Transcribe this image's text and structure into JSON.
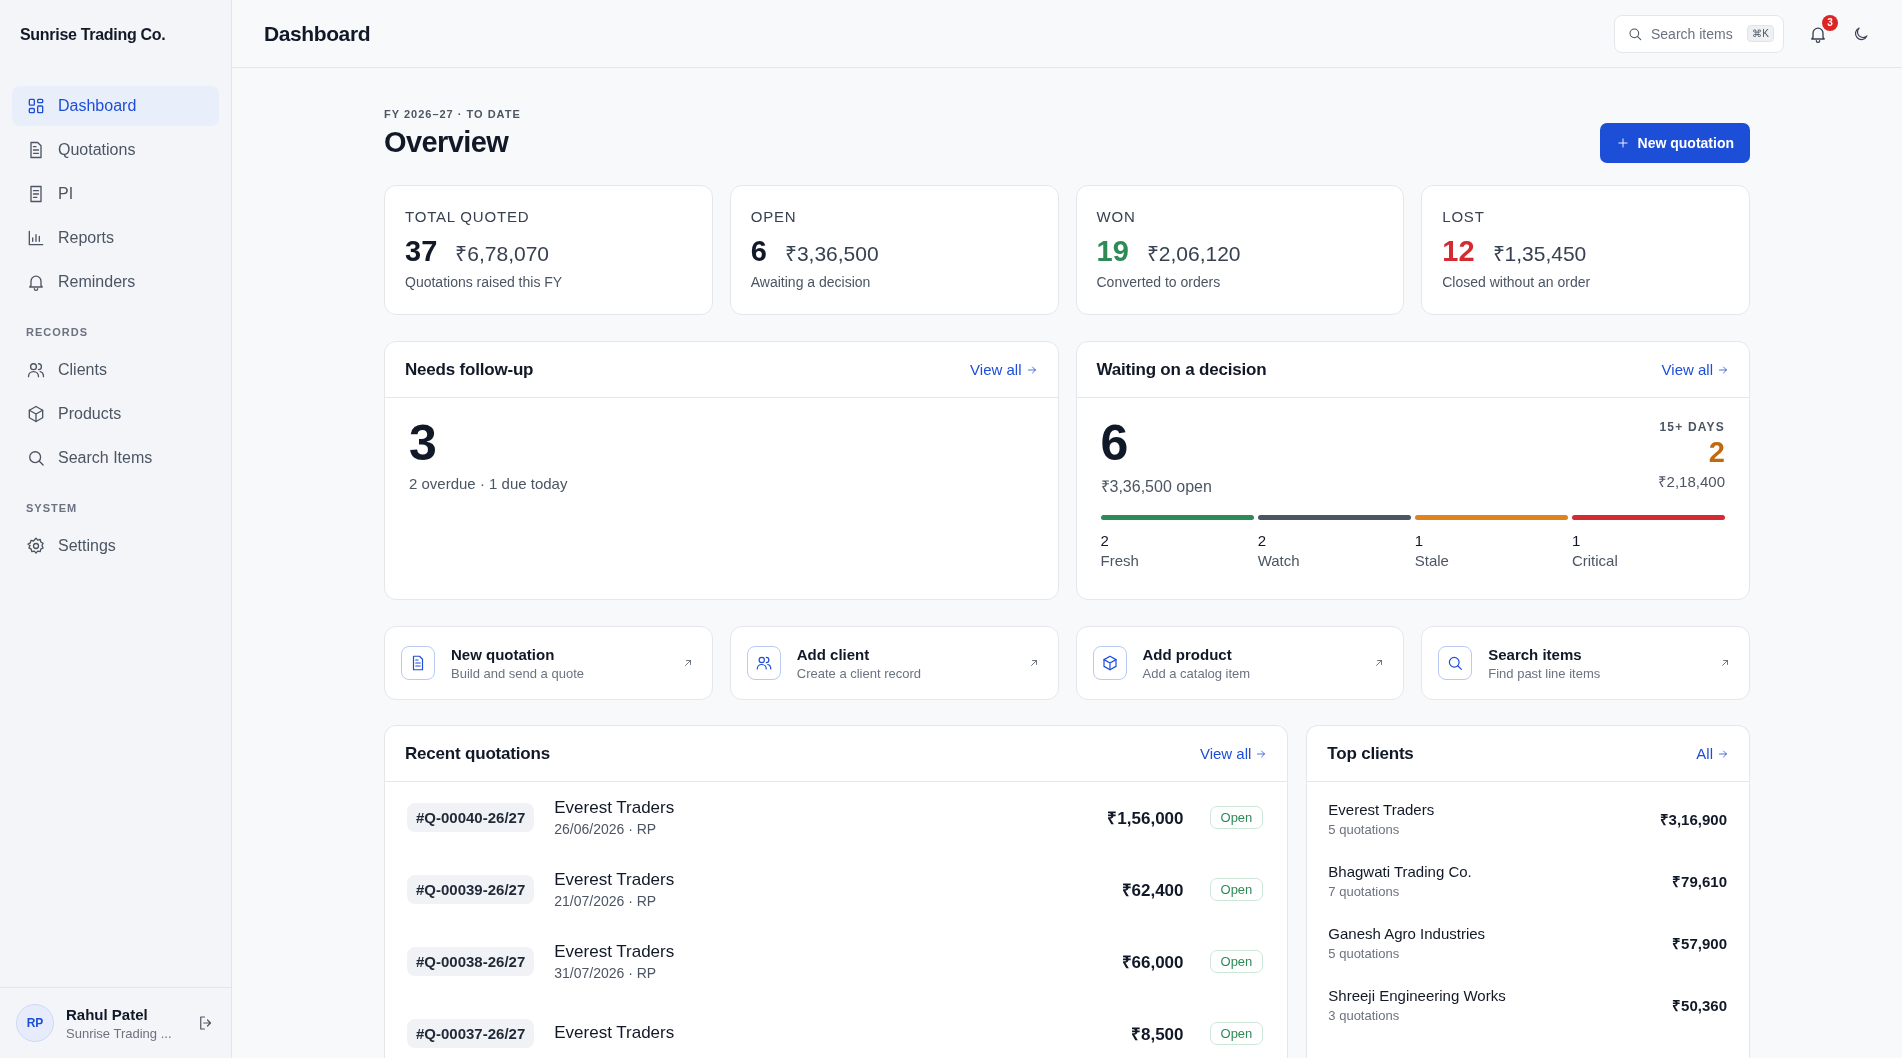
{
  "sidebar": {
    "brand": "Sunrise Trading Co.",
    "sections": [
      {
        "items": [
          {
            "label": "Dashboard",
            "selected": true
          },
          {
            "label": "Quotations",
            "selected": false
          },
          {
            "label": "PI",
            "selected": false
          },
          {
            "label": "Reports",
            "selected": false
          },
          {
            "label": "Reminders",
            "selected": false
          }
        ]
      },
      {
        "title": "RECORDS",
        "items": [
          {
            "label": "Clients",
            "selected": false
          },
          {
            "label": "Products",
            "selected": false
          },
          {
            "label": "Search Items",
            "selected": false
          }
        ]
      },
      {
        "title": "SYSTEM",
        "items": [
          {
            "label": "Settings",
            "selected": false
          }
        ]
      }
    ],
    "user": {
      "initials": "RP",
      "name": "Rahul Patel",
      "company": "Sunrise Trading ..."
    }
  },
  "header": {
    "title": "Dashboard",
    "search": {
      "placeholder": "Search items",
      "shortcut": "⌘K"
    },
    "notifications": "3"
  },
  "overview": {
    "period": "FY 2026–27 · TO DATE",
    "title": "Overview",
    "new_button": "New quotation"
  },
  "stats": [
    {
      "label": "TOTAL QUOTED",
      "count": "37",
      "kind": "neutral",
      "amount": "₹6,78,070",
      "note": "Quotations raised this FY"
    },
    {
      "label": "OPEN",
      "count": "6",
      "kind": "neutral",
      "amount": "₹3,36,500",
      "note": "Awaiting a decision"
    },
    {
      "label": "WON",
      "count": "19",
      "kind": "success",
      "amount": "₹2,06,120",
      "note": "Converted to orders"
    },
    {
      "label": "LOST",
      "count": "12",
      "kind": "danger",
      "amount": "₹1,35,450",
      "note": "Closed without an order"
    }
  ],
  "follow_up": {
    "title": "Needs follow-up",
    "link": "View all",
    "count": "3",
    "note": "2 overdue · 1 due today"
  },
  "waiting": {
    "title": "Waiting on a decision",
    "link": "View all",
    "count": "6",
    "amount": "₹3,36,500",
    "amount_suffix": "open",
    "aged_label": "15+ DAYS",
    "aged_count": "2",
    "aged_amount": "₹2,18,400",
    "stages": [
      {
        "count": "2",
        "label": "Fresh",
        "color": "#2e8b57"
      },
      {
        "count": "2",
        "label": "Watch",
        "color": "#4b5563"
      },
      {
        "count": "1",
        "label": "Stale",
        "color": "#e0821e"
      },
      {
        "count": "1",
        "label": "Critical",
        "color": "#d42a32"
      }
    ]
  },
  "quick_actions": [
    {
      "title": "New quotation",
      "subtitle": "Build and send a quote"
    },
    {
      "title": "Add client",
      "subtitle": "Create a client record"
    },
    {
      "title": "Add product",
      "subtitle": "Add a catalog item"
    },
    {
      "title": "Search items",
      "subtitle": "Find past line items"
    }
  ],
  "recent": {
    "title": "Recent quotations",
    "link": "View all",
    "rows": [
      {
        "number": "#Q-00040-26/27",
        "client": "Everest Traders",
        "meta": "26/06/2026 · RP",
        "amount": "₹1,56,000",
        "status": "Open",
        "kind": "open"
      },
      {
        "number": "#Q-00039-26/27",
        "client": "Everest Traders",
        "meta": "21/07/2026 · RP",
        "amount": "₹62,400",
        "status": "Open",
        "kind": "open"
      },
      {
        "number": "#Q-00038-26/27",
        "client": "Everest Traders",
        "meta": "31/07/2026 · RP",
        "amount": "₹66,000",
        "status": "Open",
        "kind": "open"
      },
      {
        "number": "#Q-00037-26/27",
        "client": "Everest Traders",
        "amount": "₹8,500",
        "status": "Open",
        "kind": "open"
      }
    ]
  },
  "top_clients": {
    "title": "Top clients",
    "link": "All",
    "rows": [
      {
        "name": "Everest Traders",
        "count": "5 quotations",
        "amount": "₹3,16,900"
      },
      {
        "name": "Bhagwati Trading Co.",
        "count": "7 quotations",
        "amount": "₹79,610"
      },
      {
        "name": "Ganesh Agro Industries",
        "count": "5 quotations",
        "amount": "₹57,900"
      },
      {
        "name": "Shreeji Engineering Works",
        "count": "3 quotations",
        "amount": "₹50,360"
      }
    ]
  }
}
